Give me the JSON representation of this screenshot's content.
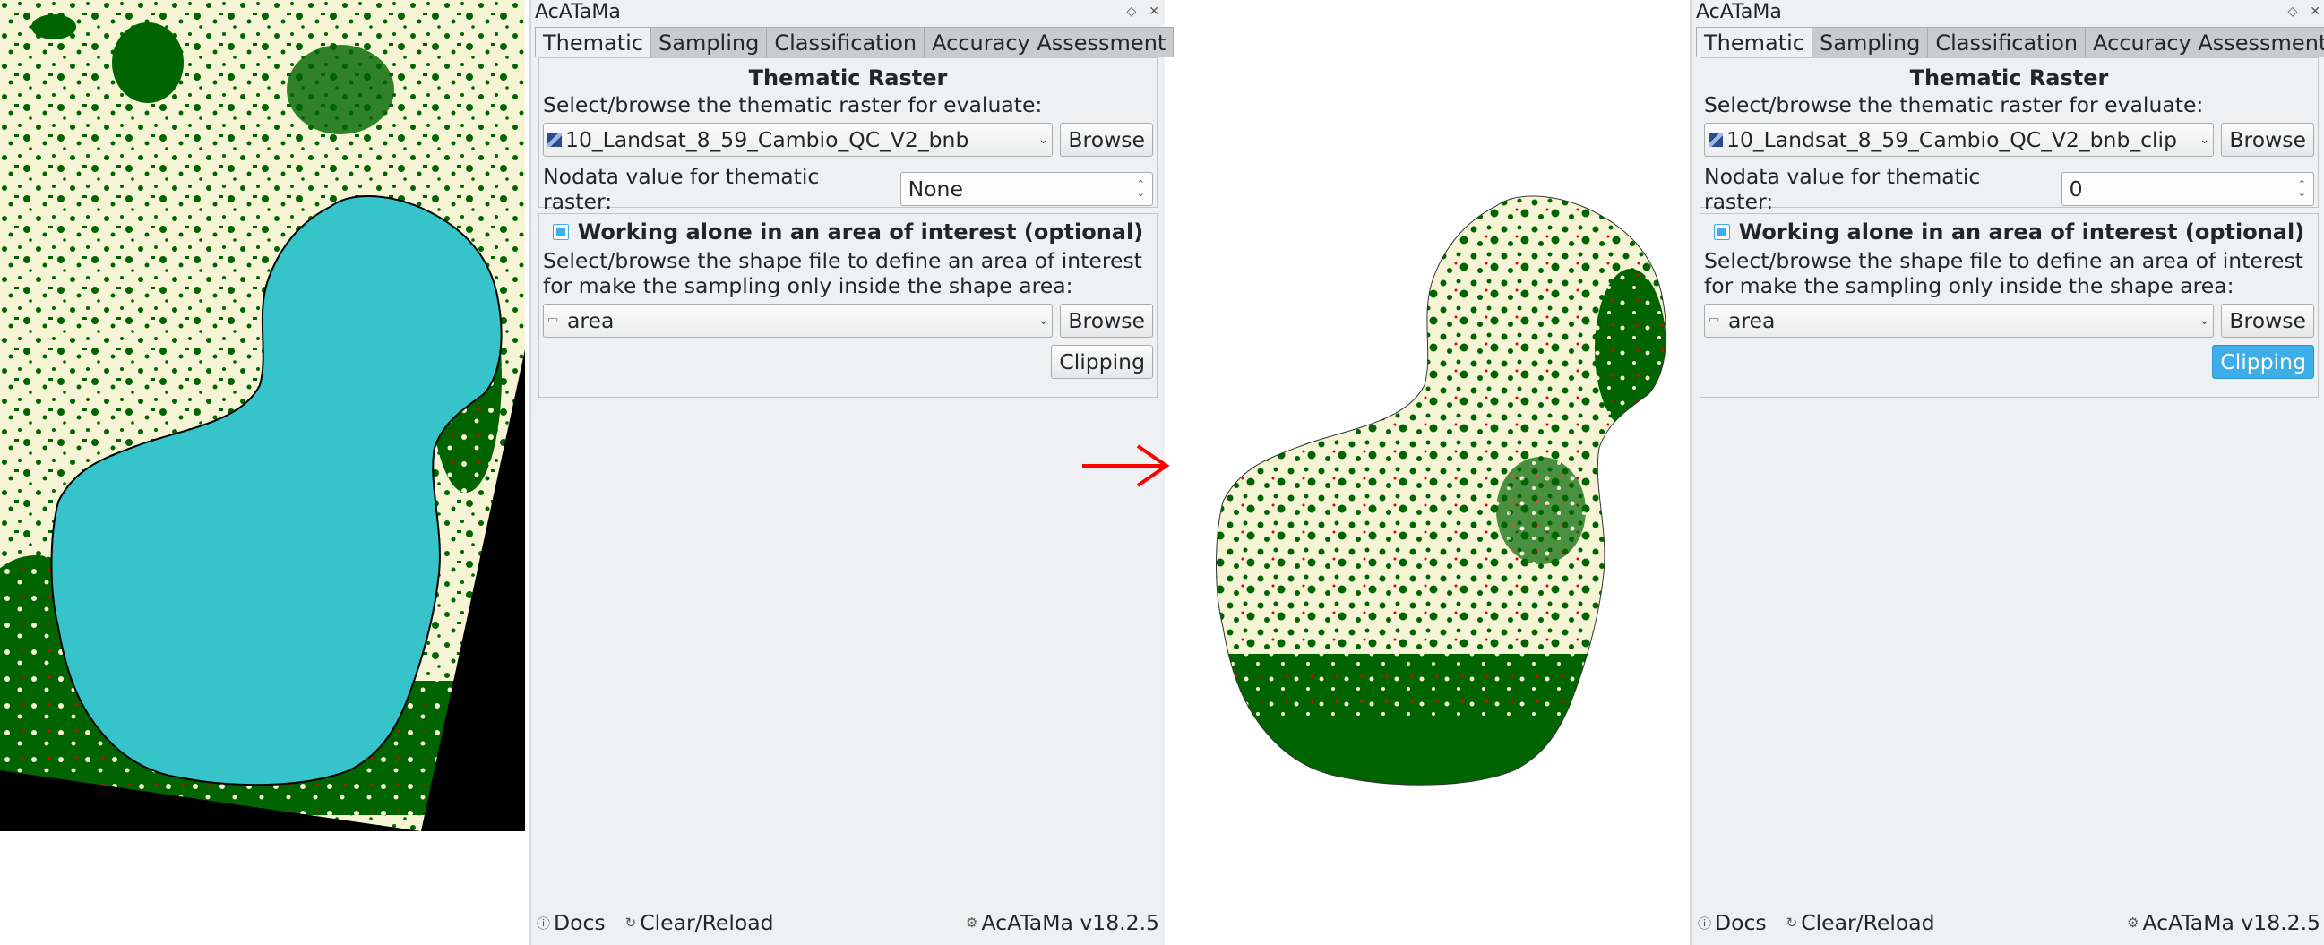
{
  "colors": {
    "land_light": "#f5f5d5",
    "forest": "#006400",
    "aoi_fill": "#36c3c9",
    "nodata": "#000000",
    "change": "#e60000",
    "arrow": "#ff0000",
    "accent": "#3daee9"
  },
  "panels": [
    {
      "window_title": "AcATaMa",
      "tabs": [
        "Thematic",
        "Sampling",
        "Classification",
        "Accuracy Assessment"
      ],
      "active_tab": "Thematic",
      "thematic_raster": {
        "title": "Thematic Raster",
        "select_label": "Select/browse the thematic raster for evaluate:",
        "raster_value": "10_Landsat_8_59_Cambio_QC_V2_bnb",
        "browse_label": "Browse",
        "nodata_label": "Nodata value for thematic raster:",
        "nodata_value": "None"
      },
      "aoi": {
        "checkbox_label": "Working alone in an area of interest (optional)",
        "checked": true,
        "description": "Select/browse the shape file to define an area of interest for make the sampling only inside the shape area:",
        "shape_value": "area",
        "browse_label": "Browse",
        "clipping_label": "Clipping",
        "clipping_active": false
      },
      "footer": {
        "docs": "Docs",
        "clear_reload": "Clear/Reload",
        "version": "AcATaMa v18.2.5"
      }
    },
    {
      "window_title": "AcATaMa",
      "tabs": [
        "Thematic",
        "Sampling",
        "Classification",
        "Accuracy Assessment"
      ],
      "active_tab": "Thematic",
      "thematic_raster": {
        "title": "Thematic Raster",
        "select_label": "Select/browse the thematic raster for evaluate:",
        "raster_value": "10_Landsat_8_59_Cambio_QC_V2_bnb_clip",
        "browse_label": "Browse",
        "nodata_label": "Nodata value for thematic raster:",
        "nodata_value": "0"
      },
      "aoi": {
        "checkbox_label": "Working alone in an area of interest (optional)",
        "checked": true,
        "description": "Select/browse the shape file to define an area of interest for make the sampling only inside the shape area:",
        "shape_value": "area",
        "browse_label": "Browse",
        "clipping_label": "Clipping",
        "clipping_active": true
      },
      "footer": {
        "docs": "Docs",
        "clear_reload": "Clear/Reload",
        "version": "AcATaMa v18.2.5"
      }
    }
  ]
}
